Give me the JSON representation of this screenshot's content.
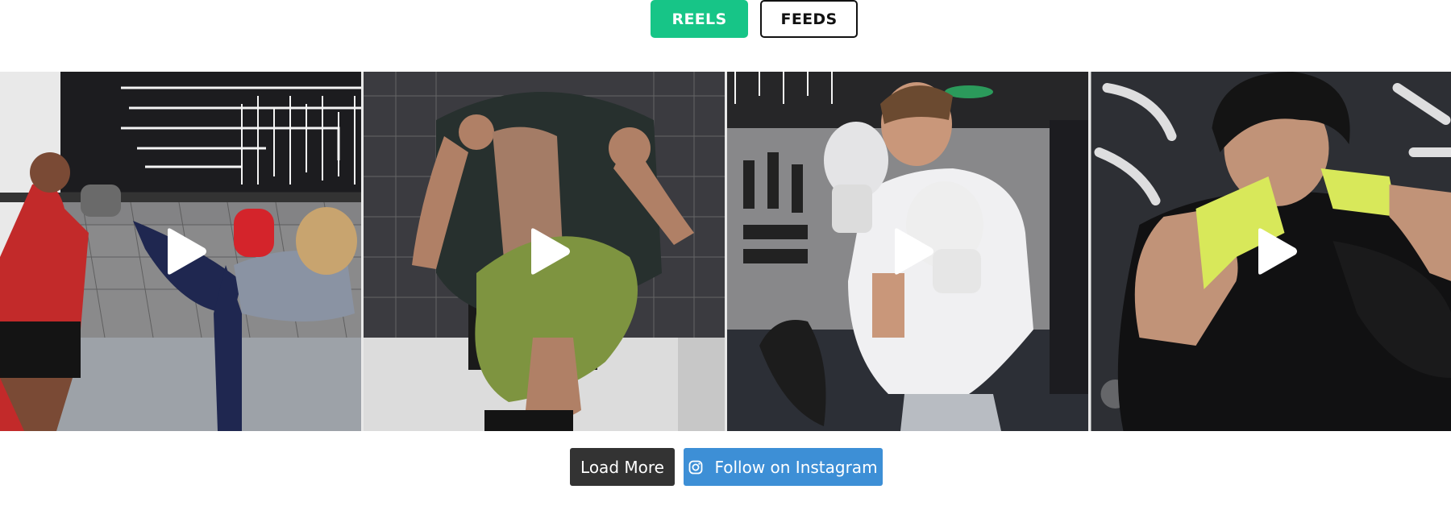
{
  "tabs": {
    "reels_label": "REELS",
    "feeds_label": "FEEDS",
    "active": "REELS"
  },
  "gallery": {
    "tiles": [
      {
        "icon": "play-icon"
      },
      {
        "icon": "play-icon"
      },
      {
        "icon": "play-icon"
      },
      {
        "icon": "play-icon"
      }
    ]
  },
  "actions": {
    "load_more_label": "Load More",
    "follow_label": "Follow on Instagram",
    "follow_icon": "instagram-icon"
  },
  "colors": {
    "accent": "#17c587",
    "load_more_bg": "#333333",
    "follow_bg": "#3d8fd6"
  }
}
